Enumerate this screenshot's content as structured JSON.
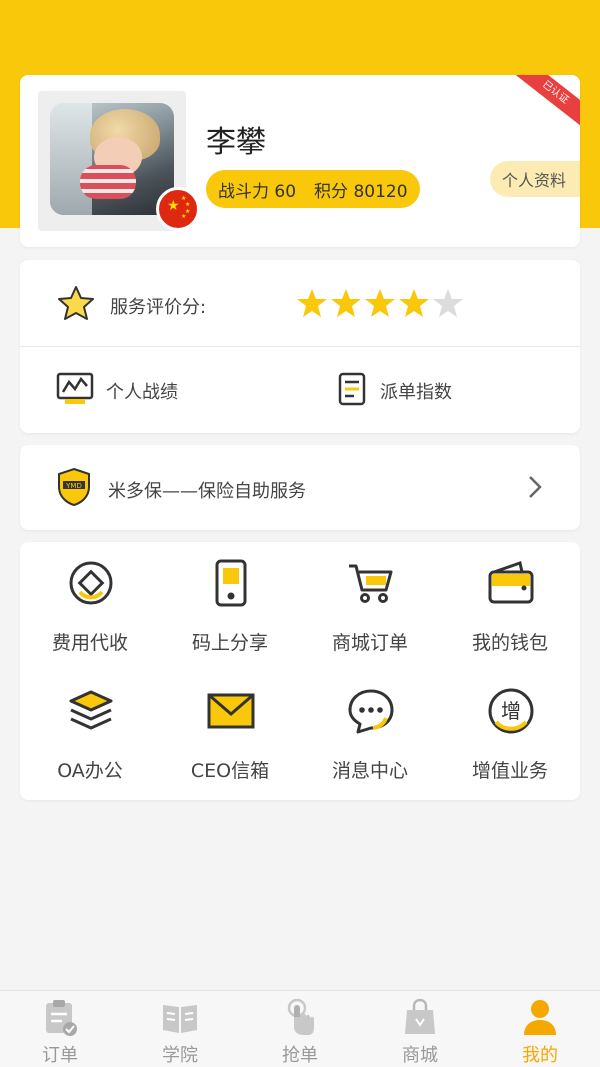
{
  "colors": {
    "accent": "#f9c80a",
    "active_tab": "#f5a800",
    "ribbon": "#e8403e"
  },
  "profile": {
    "name": "李攀",
    "power_label": "战斗力",
    "power_value": "60",
    "points_label": "积分",
    "points_value": "80120",
    "profile_button": "个人资料",
    "verified_ribbon": "已认证",
    "flag_icon": "china-flag-icon"
  },
  "rating": {
    "label": "服务评价分:",
    "stars_filled": 4,
    "stars_total": 5
  },
  "links": {
    "performance": "个人战绩",
    "dispatch_index": "派单指数"
  },
  "insurance": {
    "badge_text": "YMD",
    "label": "米多保——保险自助服务"
  },
  "grid": [
    {
      "label": "费用代收",
      "icon": "coin-icon"
    },
    {
      "label": "码上分享",
      "icon": "phone-qr-icon"
    },
    {
      "label": "商城订单",
      "icon": "cart-icon"
    },
    {
      "label": "我的钱包",
      "icon": "wallet-icon"
    },
    {
      "label": "OA办公",
      "icon": "layers-icon"
    },
    {
      "label": "CEO信箱",
      "icon": "mail-icon"
    },
    {
      "label": "消息中心",
      "icon": "chat-icon"
    },
    {
      "label": "增值业务",
      "icon": "value-added-icon",
      "glyph": "增"
    }
  ],
  "nav": [
    {
      "label": "订单",
      "icon": "clipboard-icon",
      "active": false
    },
    {
      "label": "学院",
      "icon": "book-icon",
      "active": false
    },
    {
      "label": "抢单",
      "icon": "tap-hand-icon",
      "active": false
    },
    {
      "label": "商城",
      "icon": "shopping-bag-icon",
      "active": false
    },
    {
      "label": "我的",
      "icon": "user-icon",
      "active": true
    }
  ]
}
